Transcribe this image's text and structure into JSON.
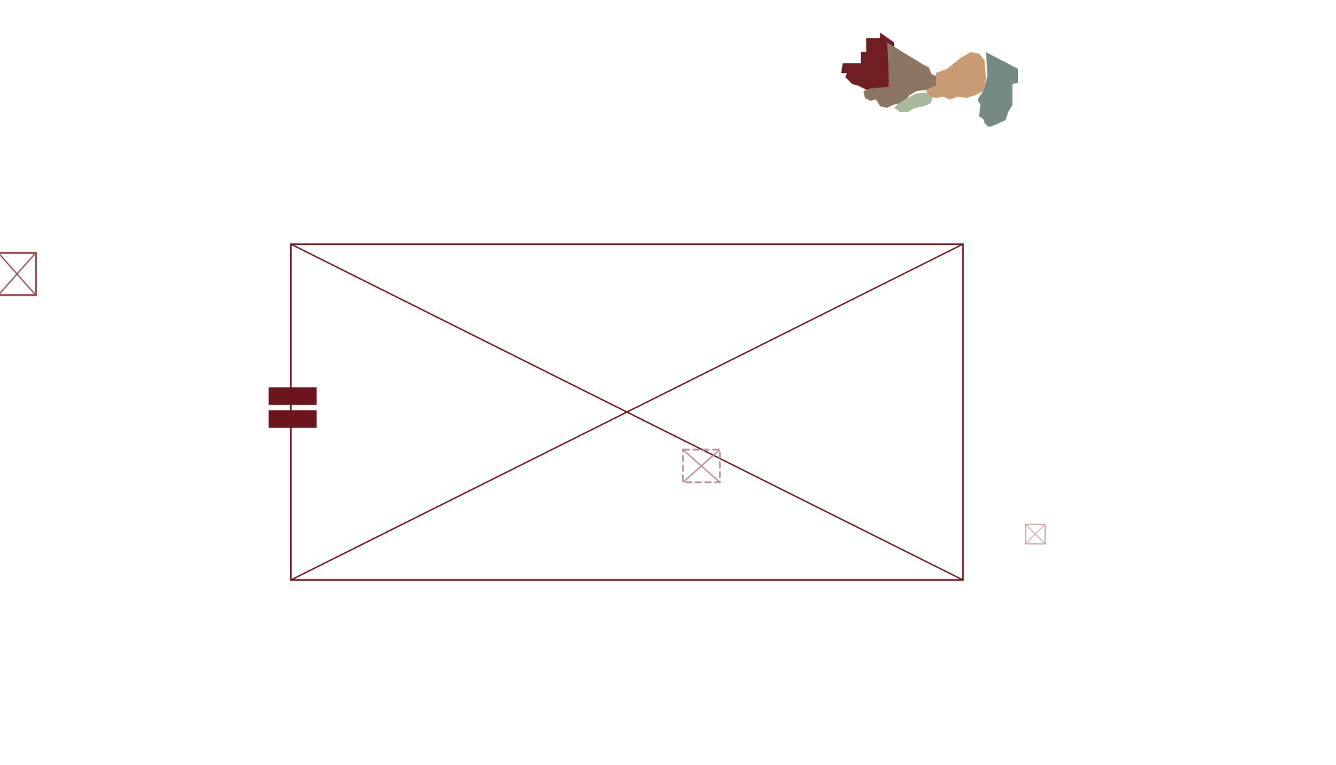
{
  "logo": {
    "icon": "sahel-map-logo-icon",
    "regions": [
      {
        "name": "region-1",
        "color": "#6f1e22"
      },
      {
        "name": "region-2",
        "color": "#8c7563"
      },
      {
        "name": "region-3",
        "color": "#a9b89d"
      },
      {
        "name": "region-4",
        "color": "#c99b73"
      },
      {
        "name": "region-5",
        "color": "#768a84"
      }
    ]
  },
  "colors": {
    "accent": "#6c161c",
    "placeholder_stroke": "#7a2a2e",
    "placeholder_light": "#c99a9c"
  },
  "images": {
    "left": {
      "icon": "broken-image-icon"
    },
    "main": {
      "icon": "broken-image-icon"
    },
    "center": {
      "icon": "broken-image-icon"
    },
    "right": {
      "icon": "broken-image-icon"
    }
  },
  "slider": {
    "icon": "pause-slider-handle-icon"
  }
}
